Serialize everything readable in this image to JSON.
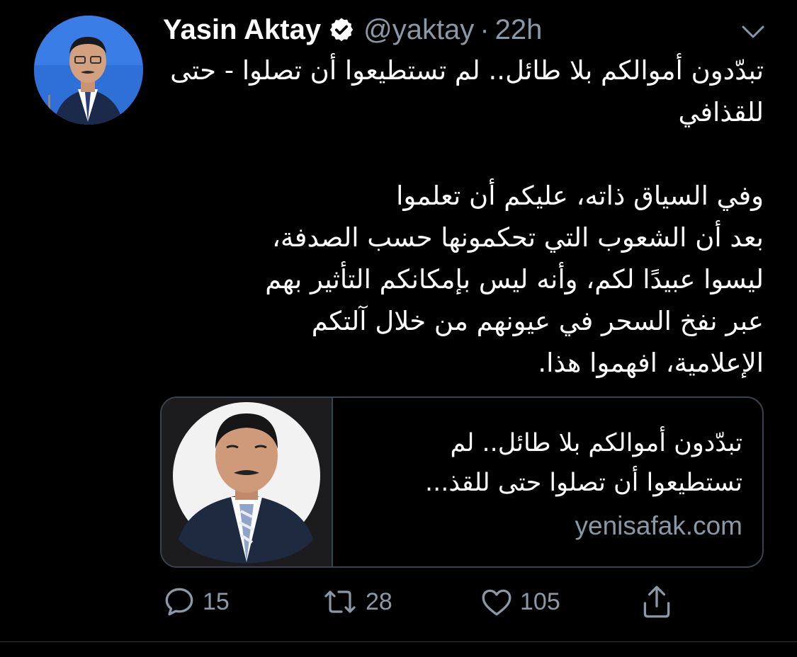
{
  "colors": {
    "background": "#000000",
    "text_primary": "#ffffff",
    "text_secondary": "#8b98a5",
    "border": "#38444d"
  },
  "tweet": {
    "author": {
      "display_name": "Yasin Aktay",
      "verified": true,
      "handle": "@yaktay",
      "separator": "·",
      "time": "22h"
    },
    "text": "تبدّدون أموالكم بلا طائل.. لم تستطيعوا أن تصلوا - حتى للقذافي\n\nوفي السياق ذاته، عليكم أن تعلموا\nبعد أن الشعوب التي تحكمونها حسب الصدفة،\nليسوا عبيدًا لكم، وأنه ليس بإمكانكم التأثير بهم\nعبر نفخ السحر في عيونهم من خلال آلتكم\nالإعلامية، افهموا هذا.",
    "card": {
      "title": "تبدّدون أموالكم بلا طائل.. لم تستطيعوا أن تصلوا حتى للقذ...",
      "domain": "yenisafak.com"
    },
    "actions": {
      "replies": "15",
      "retweets": "28",
      "likes": "105"
    }
  },
  "icons": [
    "verified-badge-icon",
    "chevron-down-icon",
    "reply-icon",
    "retweet-icon",
    "like-icon",
    "share-icon"
  ]
}
